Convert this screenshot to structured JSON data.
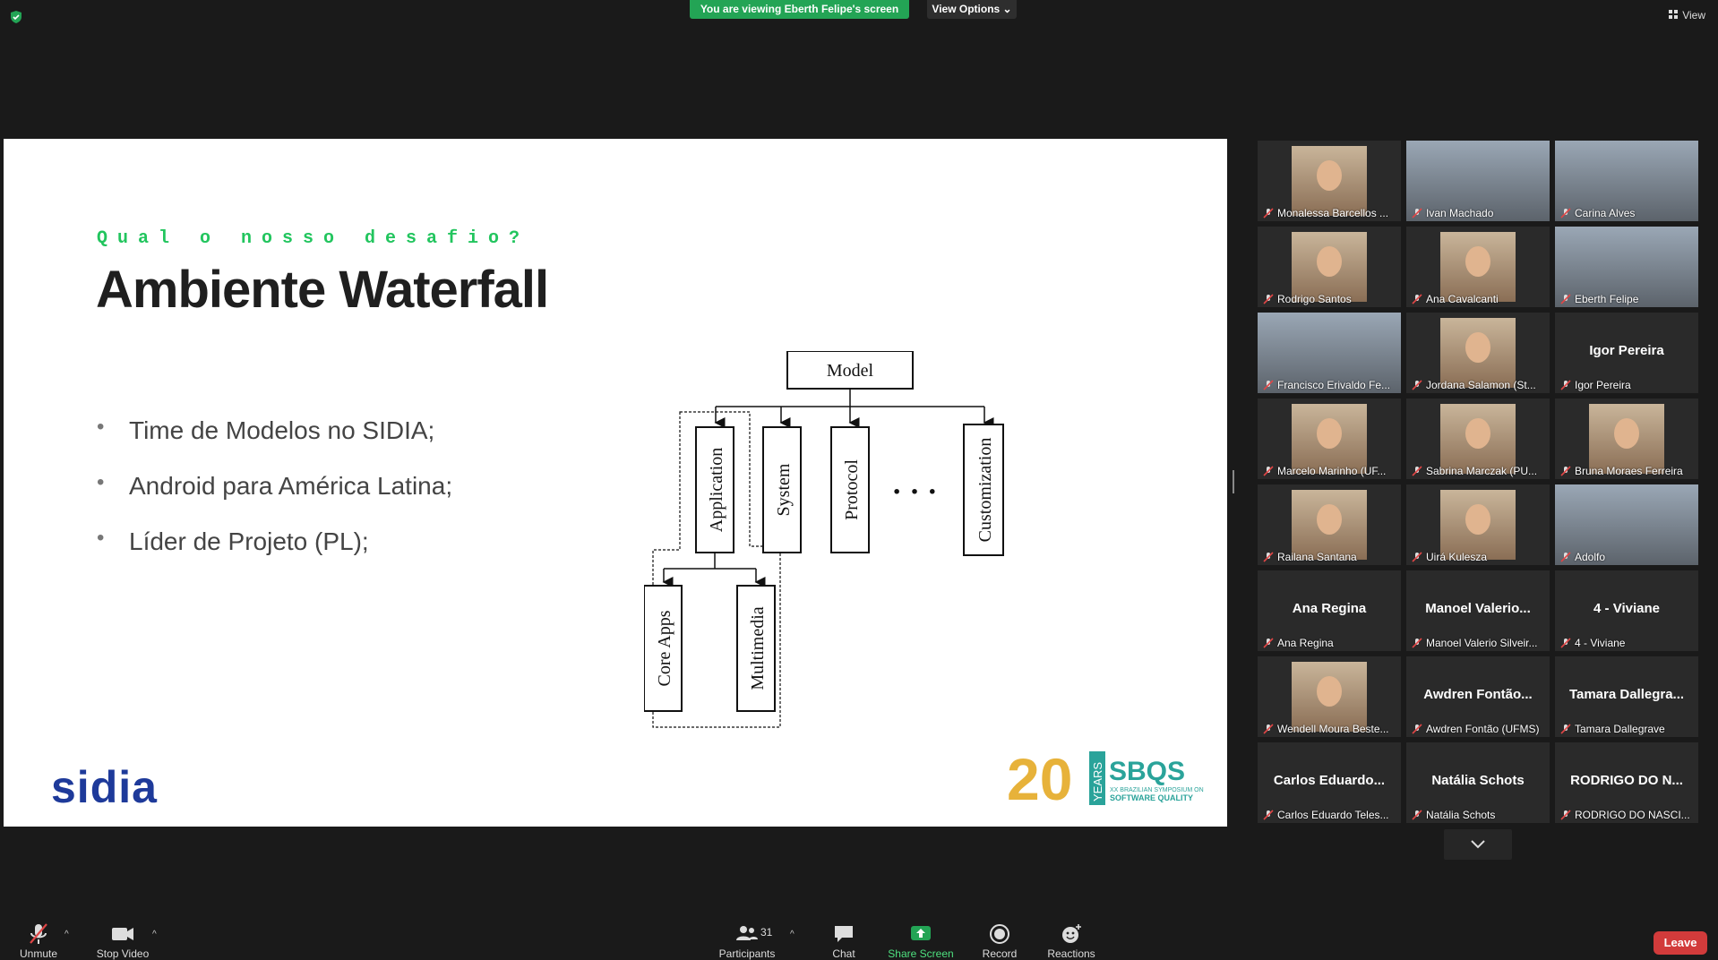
{
  "top": {
    "viewing_text": "You are viewing Eberth Felipe's screen",
    "view_options": "View Options ⌄",
    "view_label": "View"
  },
  "slide": {
    "subtitle": "Qual o nosso desafio?",
    "title": "Ambiente Waterfall",
    "bullets": [
      "Time de Modelos no SIDIA;",
      "Android para América Latina;",
      "Líder de Projeto (PL);"
    ],
    "diagram": {
      "root": "Model",
      "children": [
        "Application",
        "System",
        "Protocol",
        "Customization"
      ],
      "ellipsis": "· · ·",
      "sub_children": [
        "Core Apps",
        "Multimedia"
      ]
    },
    "logo_left": "sidia",
    "logo_right": {
      "number": "20",
      "years": "YEARS",
      "brand": "SBQS",
      "line1": "XX BRAZILIAN SYMPOSIUM ON",
      "line2": "SOFTWARE QUALITY"
    }
  },
  "gallery": {
    "tiles": [
      {
        "name": "Monalessa Barcellos ...",
        "big": "",
        "video": "face"
      },
      {
        "name": "Ivan Machado",
        "big": "",
        "video": "wide"
      },
      {
        "name": "Carina Alves",
        "big": "",
        "video": "wide"
      },
      {
        "name": "Rodrigo Santos",
        "big": "",
        "video": "face"
      },
      {
        "name": "Ana Cavalcanti",
        "big": "",
        "video": "face"
      },
      {
        "name": "Eberth Felipe",
        "big": "",
        "video": "wide",
        "active": true
      },
      {
        "name": "Francisco Erivaldo Fe...",
        "big": "",
        "video": "wide"
      },
      {
        "name": "Jordana Salamon (St...",
        "big": "",
        "video": "face"
      },
      {
        "name": "Igor Pereira",
        "big": "Igor Pereira",
        "video": "none"
      },
      {
        "name": "Marcelo Marinho (UF...",
        "big": "",
        "video": "face"
      },
      {
        "name": "Sabrina Marczak (PU...",
        "big": "",
        "video": "face"
      },
      {
        "name": "Bruna Moraes Ferreira",
        "big": "",
        "video": "face"
      },
      {
        "name": "Railana Santana",
        "big": "",
        "video": "face"
      },
      {
        "name": "Uirá Kulesza",
        "big": "",
        "video": "face"
      },
      {
        "name": "Adolfo",
        "big": "",
        "video": "wide"
      },
      {
        "name": "Ana Regina",
        "big": "Ana Regina",
        "video": "none"
      },
      {
        "name": "Manoel Valerio Silveir...",
        "big": "Manoel  Valerio...",
        "video": "none"
      },
      {
        "name": "4 - Viviane",
        "big": "4 - Viviane",
        "video": "none"
      },
      {
        "name": "Wendell Moura Beste...",
        "big": "",
        "video": "face"
      },
      {
        "name": "Awdren Fontão (UFMS)",
        "big": "Awdren  Fontão...",
        "video": "none"
      },
      {
        "name": "Tamara Dallegrave",
        "big": "Tamara  Dallegra...",
        "video": "none"
      },
      {
        "name": "Carlos Eduardo Teles...",
        "big": "Carlos  Eduardo...",
        "video": "none"
      },
      {
        "name": "Natália Schots",
        "big": "Natália Schots",
        "video": "none"
      },
      {
        "name": "RODRIGO DO NASCI...",
        "big": "RODRIGO DO N...",
        "video": "none"
      }
    ]
  },
  "toolbar": {
    "unmute": "Unmute",
    "stop_video": "Stop Video",
    "participants": "Participants",
    "participants_count": "31",
    "chat": "Chat",
    "share_screen": "Share Screen",
    "record": "Record",
    "reactions": "Reactions",
    "leave": "Leave",
    "caret": "^"
  },
  "colors": {
    "green": "#23a455",
    "accent_text": "#22c55e",
    "leave": "#d23b3b",
    "active_border": "#e1e36b"
  }
}
